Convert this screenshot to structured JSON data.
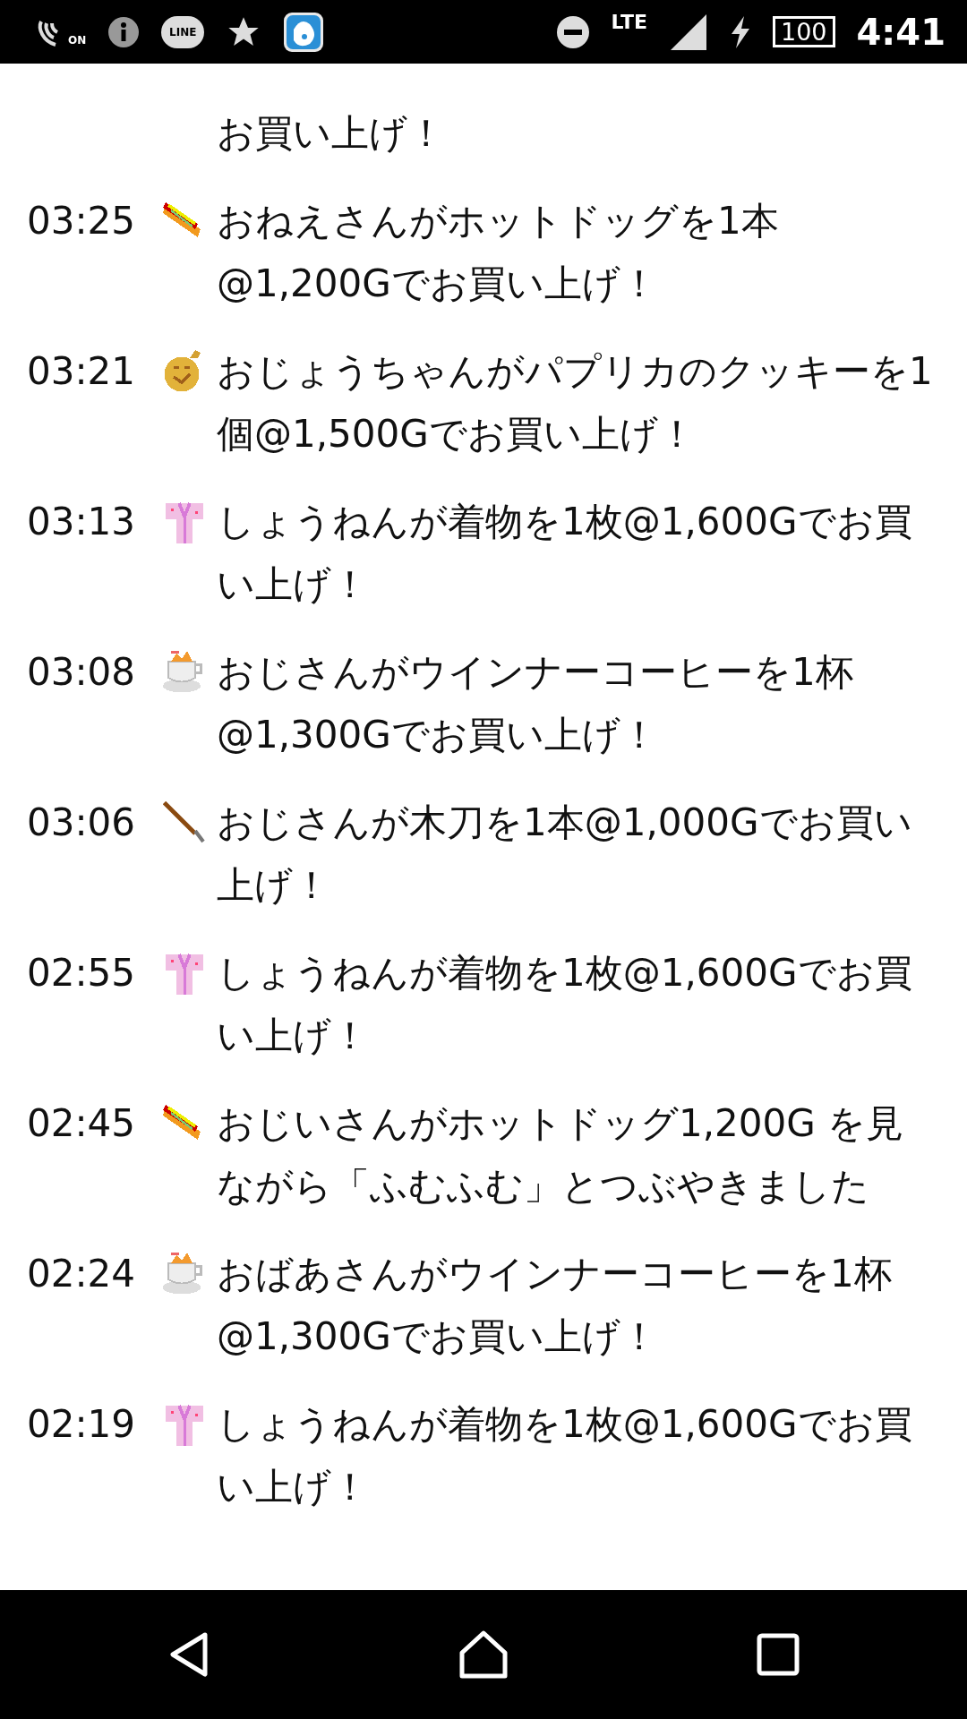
{
  "status_bar": {
    "nfc_label": "ON",
    "line_label": "LINE",
    "network": "LTE",
    "battery": "100",
    "time": "4:41"
  },
  "log_top_continuation": "お買い上げ！",
  "log": [
    {
      "time": "03:25",
      "kind": "hotdog",
      "text": "おねえさんがホットドッグを1本@1,200Gでお買い上げ！"
    },
    {
      "time": "03:21",
      "kind": "cookie",
      "text": "おじょうちゃんがパプリカのクッキーを1個@1,500Gでお買い上げ！"
    },
    {
      "time": "03:13",
      "kind": "kimono",
      "text": "しょうねんが着物を1枚@1,600Gでお買い上げ！"
    },
    {
      "time": "03:08",
      "kind": "coffee",
      "text": "おじさんがウインナーコーヒーを1杯@1,300Gでお買い上げ！"
    },
    {
      "time": "03:06",
      "kind": "sword",
      "text": "おじさんが木刀を1本@1,000Gでお買い上げ！"
    },
    {
      "time": "02:55",
      "kind": "kimono",
      "text": "しょうねんが着物を1枚@1,600Gでお買い上げ！"
    },
    {
      "time": "02:45",
      "kind": "hotdog",
      "text": "おじいさんがホットドッグ1,200G を見ながら「ふむふむ」とつぶやきました"
    },
    {
      "time": "02:24",
      "kind": "coffee",
      "text": "おばあさんがウインナーコーヒーを1杯@1,300Gでお買い上げ！"
    },
    {
      "time": "02:19",
      "kind": "kimono",
      "text": "しょうねんが着物を1枚@1,600Gでお買い上げ！"
    }
  ]
}
